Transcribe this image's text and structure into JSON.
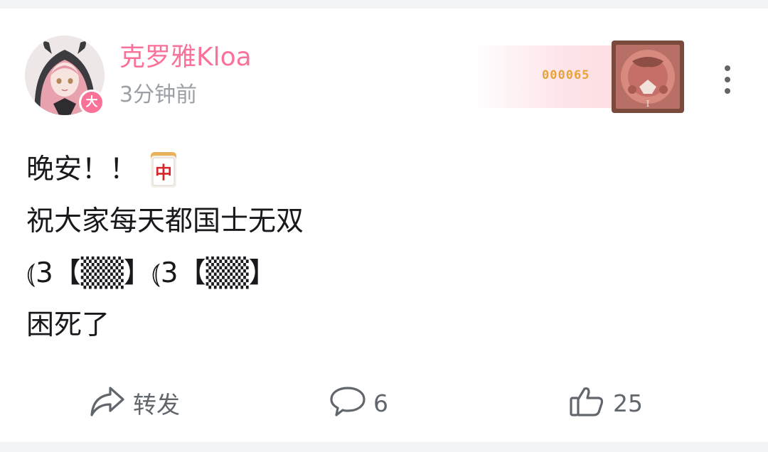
{
  "post": {
    "user": {
      "name": "克罗雅Kloa",
      "badge": "大",
      "time": "3分钟前"
    },
    "fan_card": {
      "number": "000065"
    },
    "content_lines": [
      "晚安！！",
      "祝大家每天都国士无双",
      "⦅3【▒▒】⦅3【▒▒】",
      "困死了"
    ],
    "emoji": {
      "mahjong_tile": "中"
    },
    "actions": {
      "share": "转发",
      "comments": "6",
      "likes": "25"
    }
  },
  "colors": {
    "username": "#fb7299",
    "fan_number": "#e8a33c",
    "muted": "#9aa0a6",
    "text": "#18191c"
  },
  "icons": [
    "share-icon",
    "comment-icon",
    "like-icon",
    "more-icon"
  ]
}
